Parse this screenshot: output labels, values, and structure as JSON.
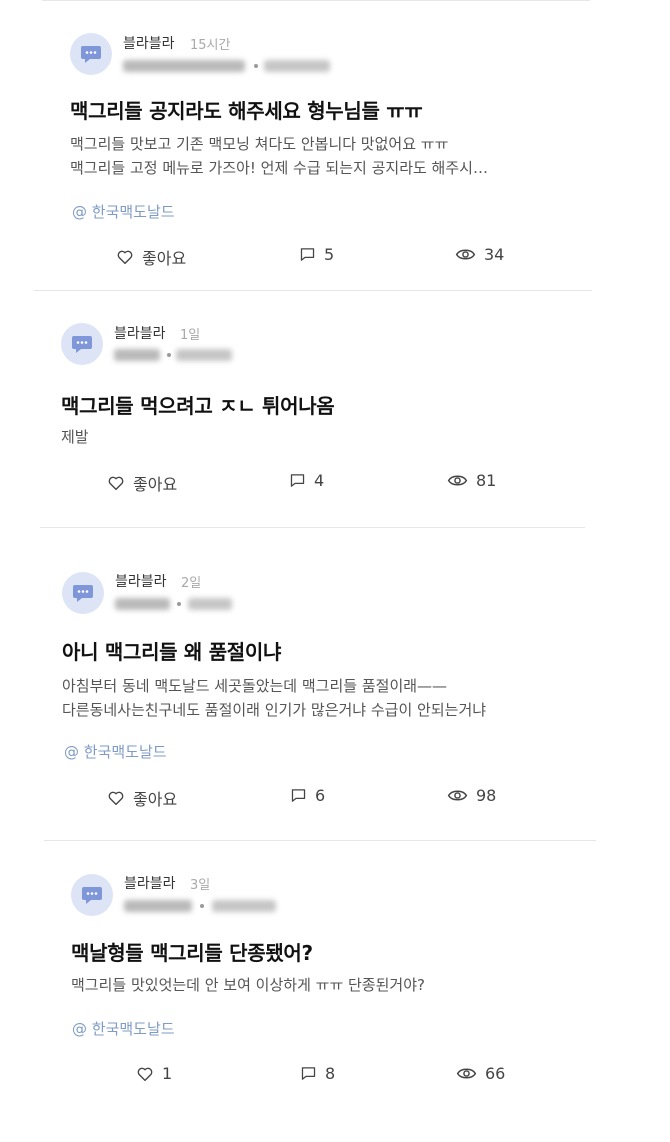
{
  "posts": [
    {
      "author": "블라블라",
      "time": "15시간",
      "title": "맥그리들 공지라도 해주세요 형누님들 ㅠㅠ",
      "body_lines": [
        "맥그리들 맛보고 기존 맥모닝 쳐다도 안봅니다 맛없어요 ㅠㅠ",
        "맥그리들 고정 메뉴로 가즈아!  언제 수급 되는지 공지라도 해주시…"
      ],
      "tag": "@ 한국맥도날드",
      "like_label": "좋아요",
      "comments": "5",
      "views": "34"
    },
    {
      "author": "블라블라",
      "time": "1일",
      "title": "맥그리들 먹으려고 ㅈㄴ 튀어나옴",
      "body_lines": [
        "제발"
      ],
      "tag": "",
      "like_label": "좋아요",
      "comments": "4",
      "views": "81"
    },
    {
      "author": "블라블라",
      "time": "2일",
      "title": "아니 맥그리들 왜 품절이냐",
      "body_lines": [
        "아침부터 동네 맥도날드 세곳돌았는데 맥그리들 품절이래——",
        "다른동네사는친구네도 품절이래 인기가 많은거냐 수급이 안되는거냐"
      ],
      "tag": "@ 한국맥도날드",
      "like_label": "좋아요",
      "comments": "6",
      "views": "98"
    },
    {
      "author": "블라블라",
      "time": "3일",
      "title": "맥날형들 맥그리들 단종됐어?",
      "body_lines": [
        "맥그리들 맛있엇는데 안 보여 이상하게 ㅠㅠ 단종된거야?"
      ],
      "tag": "@ 한국맥도날드",
      "like_label": "1",
      "comments": "8",
      "views": "66"
    }
  ],
  "icons": {
    "avatar": "chat-bubble-icon",
    "like": "heart-icon",
    "comment": "comment-icon",
    "views": "eye-icon"
  },
  "colors": {
    "avatar_bg": "#dde4f6",
    "avatar_icon": "#7f96d8",
    "tag": "#7f9bc7",
    "time": "#a9a9a9"
  }
}
